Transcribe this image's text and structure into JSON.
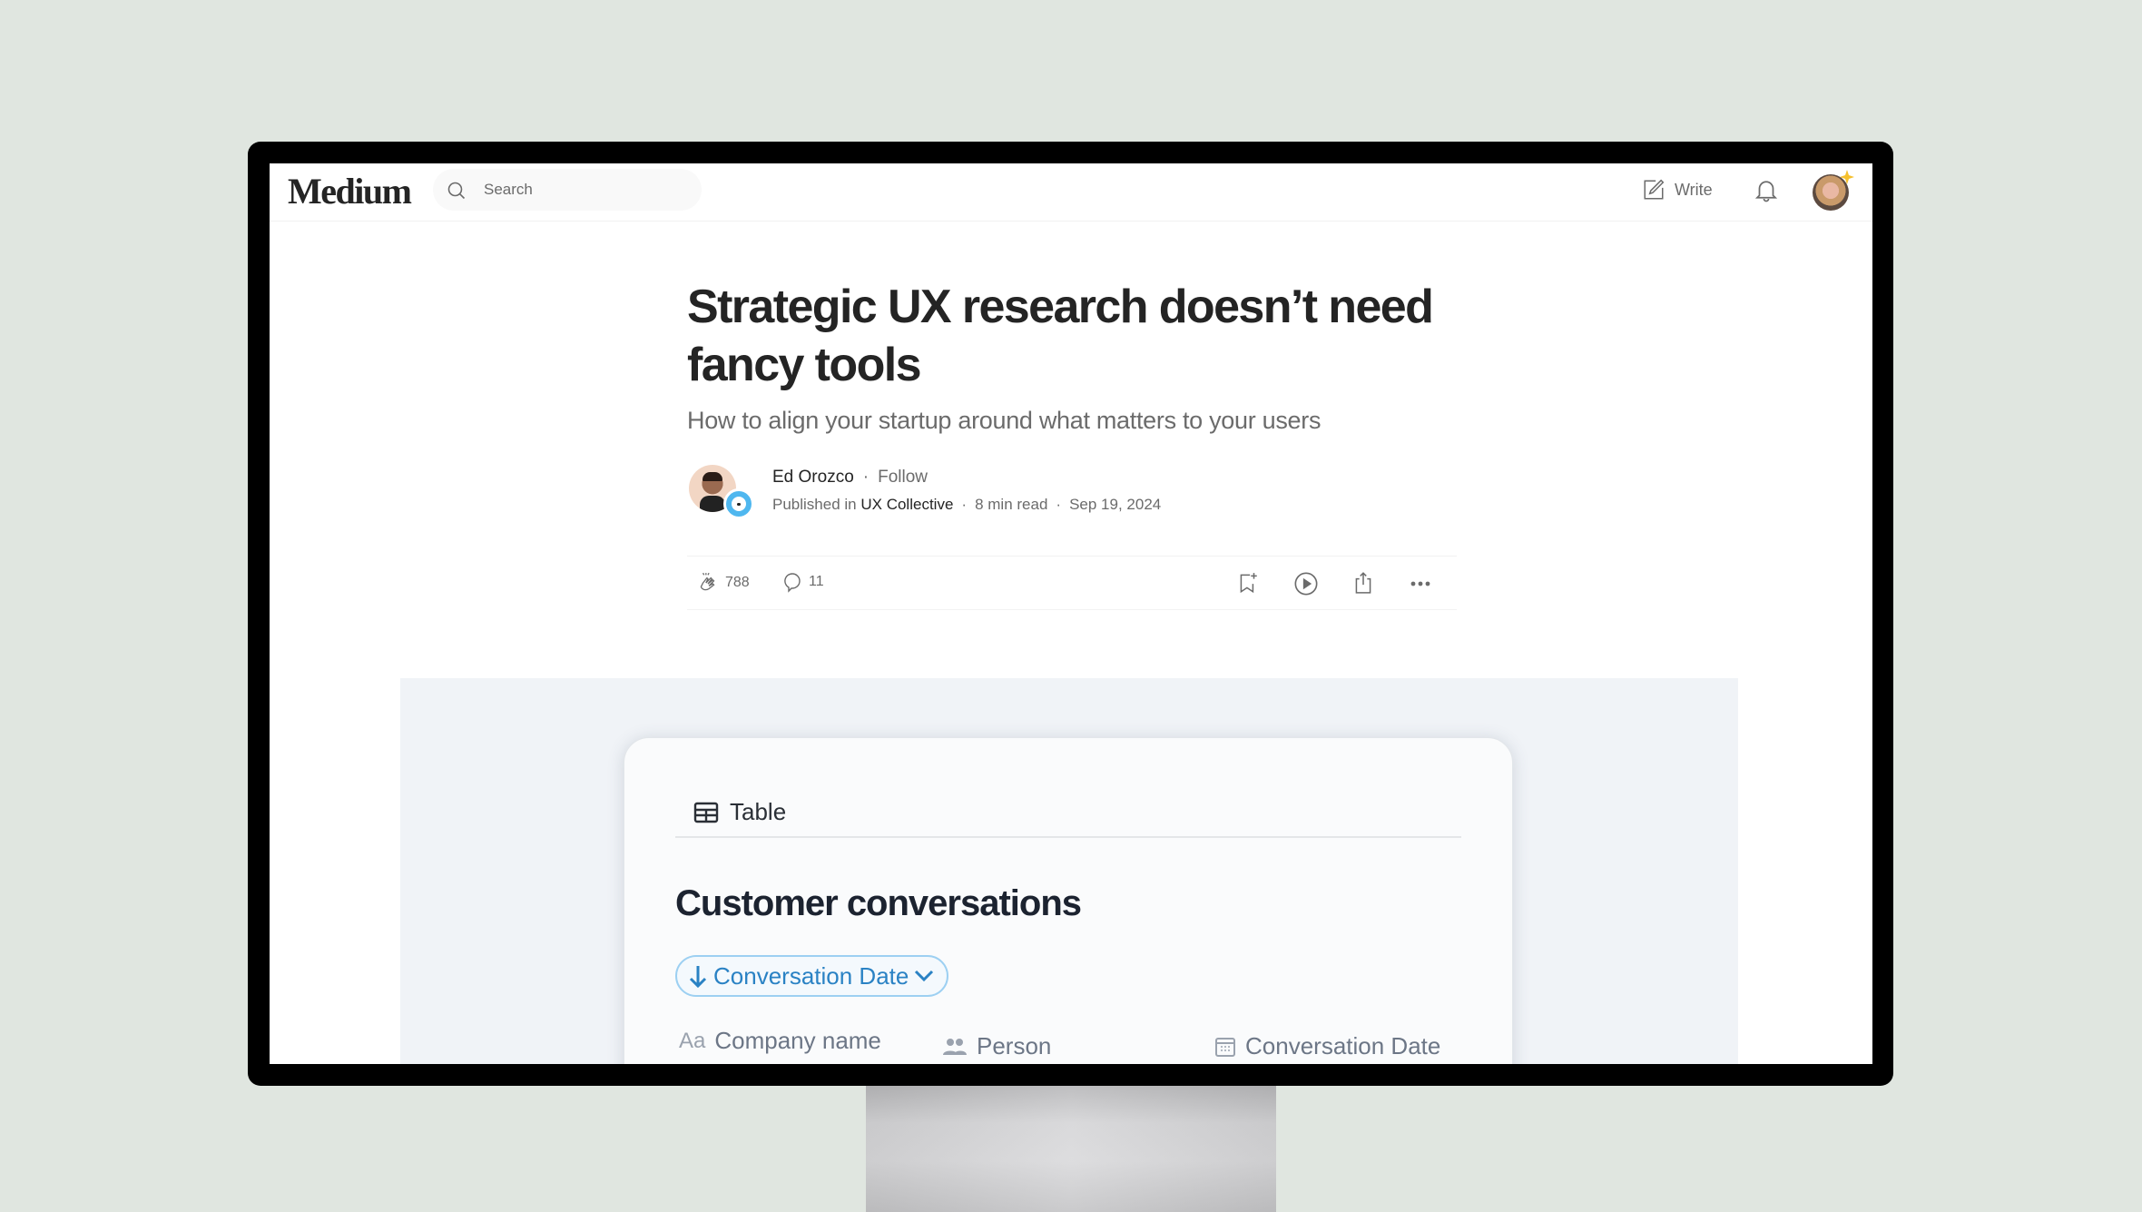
{
  "navbar": {
    "logo": "Medium",
    "search_placeholder": "Search",
    "write_label": "Write",
    "icons": [
      "search-icon",
      "write-icon",
      "bell-icon",
      "avatar"
    ]
  },
  "article": {
    "title": "Strategic UX research doesn’t need fancy tools",
    "subtitle": "How to align your startup around what matters to your users",
    "author": "Ed Orozco",
    "follow_label": "Follow",
    "published_prefix": "Published in",
    "publication": "UX Collective",
    "read_time": "8 min read",
    "date": "Sep 19, 2024",
    "separator": "·"
  },
  "actions": {
    "claps": "788",
    "comments": "11",
    "icons": [
      "clap-icon",
      "comment-icon",
      "bookmark-add-icon",
      "play-icon",
      "share-icon",
      "more-icon"
    ]
  },
  "hero": {
    "tab_label": "Table",
    "title": "Customer conversations",
    "sort_label": "Conversation Date",
    "columns": [
      {
        "icon": "Aa",
        "label": "Company name"
      },
      {
        "icon": "person-icon",
        "label": "Person"
      },
      {
        "icon": "calendar-icon",
        "label": "Conversation Date"
      }
    ]
  },
  "colors": {
    "background": "#e0e6e0",
    "text_primary": "#242424",
    "text_secondary": "#6b6b6b",
    "accent_blue": "#2a82c4",
    "sparkle": "#f6c02d"
  }
}
